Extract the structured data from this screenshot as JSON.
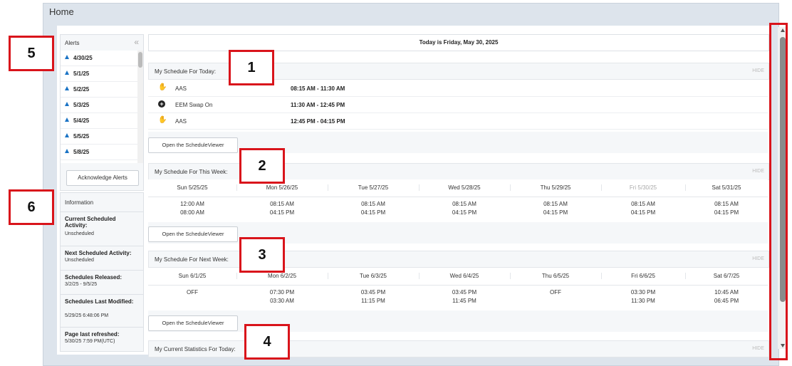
{
  "page": {
    "title": "Home"
  },
  "alerts": {
    "title": "Alerts",
    "items": [
      "4/30/25",
      "5/1/25",
      "5/2/25",
      "5/3/25",
      "5/4/25",
      "5/5/25",
      "5/8/25"
    ],
    "acknowledge_label": "Acknowledge Alerts"
  },
  "information": {
    "title": "Information",
    "items": [
      {
        "label": "Current Scheduled Activity:",
        "value": "Unscheduled"
      },
      {
        "label": "Next Scheduled Activity:",
        "value": "Unscheduled"
      },
      {
        "label": "Schedules Released:",
        "value": "3/2/25 - 9/5/25"
      },
      {
        "label": "Schedules Last Modified:",
        "value": "5/29/25 6:48:06 PM"
      },
      {
        "label": "Page last refreshed:",
        "value": "5/30/25 7:59 PM(UTC)"
      }
    ]
  },
  "today_banner": "Today is Friday, May 30, 2025",
  "hide_label": "HIDE",
  "open_viewer_label": "Open the ScheduleViewer",
  "schedule_today": {
    "title": "My Schedule For Today:",
    "rows": [
      {
        "icon": "hand-icon",
        "activity": "AAS",
        "time": "08:15 AM - 11:30 AM"
      },
      {
        "icon": "plus-circle-icon",
        "activity": "EEM Swap On",
        "time": "11:30 AM - 12:45 PM"
      },
      {
        "icon": "hand-icon",
        "activity": "AAS",
        "time": "12:45 PM - 04:15 PM"
      }
    ]
  },
  "schedule_week": {
    "title": "My Schedule For This Week:",
    "days": [
      {
        "day": "Sun 5/25/25",
        "start": "12:00 AM",
        "end": "08:00 AM"
      },
      {
        "day": "Mon 5/26/25",
        "start": "08:15 AM",
        "end": "04:15 PM"
      },
      {
        "day": "Tue 5/27/25",
        "start": "08:15 AM",
        "end": "04:15 PM"
      },
      {
        "day": "Wed 5/28/25",
        "start": "08:15 AM",
        "end": "04:15 PM"
      },
      {
        "day": "Thu 5/29/25",
        "start": "08:15 AM",
        "end": "04:15 PM"
      },
      {
        "day": "Fri 5/30/25",
        "start": "08:15 AM",
        "end": "04:15 PM"
      },
      {
        "day": "Sat 5/31/25",
        "start": "08:15 AM",
        "end": "04:15 PM"
      }
    ]
  },
  "schedule_next_week": {
    "title": "My Schedule For Next Week:",
    "days": [
      {
        "day": "Sun 6/1/25",
        "start": "OFF",
        "end": ""
      },
      {
        "day": "Mon 6/2/25",
        "start": "07:30 PM",
        "end": "03:30 AM"
      },
      {
        "day": "Tue 6/3/25",
        "start": "03:45 PM",
        "end": "11:15 PM"
      },
      {
        "day": "Wed 6/4/25",
        "start": "03:45 PM",
        "end": "11:45 PM"
      },
      {
        "day": "Thu 6/5/25",
        "start": "OFF",
        "end": ""
      },
      {
        "day": "Fri 6/6/25",
        "start": "03:30 PM",
        "end": "11:30 PM"
      },
      {
        "day": "Sat 6/7/25",
        "start": "10:45 AM",
        "end": "06:45 PM"
      }
    ]
  },
  "statistics": {
    "title": "My Current Statistics For Today:"
  },
  "annotations": [
    "1",
    "2",
    "3",
    "4",
    "5",
    "6"
  ]
}
